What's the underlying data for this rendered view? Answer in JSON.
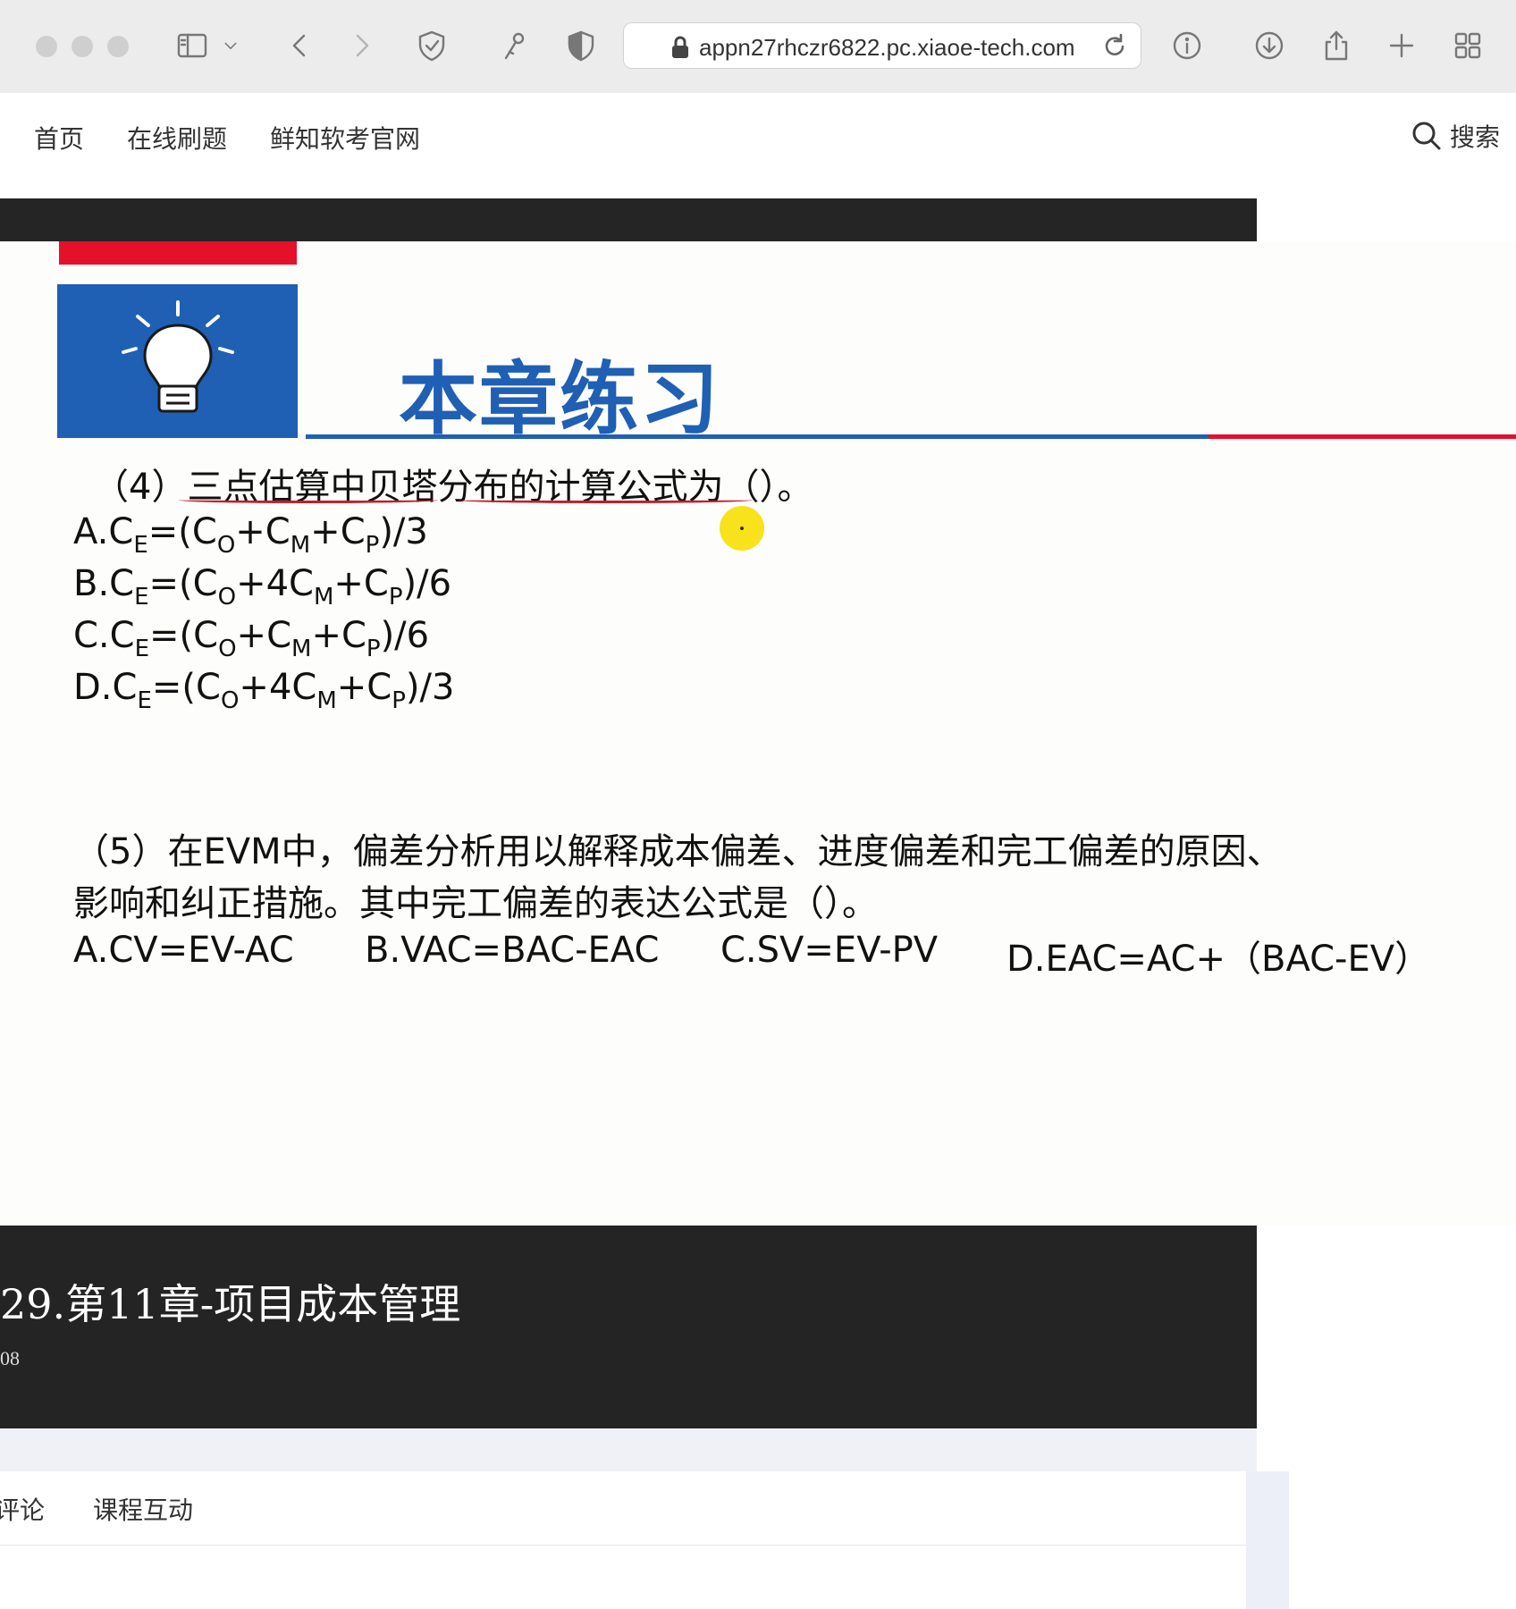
{
  "browser": {
    "url": "appn27rhczr6822.pc.xiaoe-tech.com",
    "icons": [
      "sidebar-icon",
      "chevron-down-icon",
      "back-icon",
      "forward-icon",
      "shield-icon",
      "key-icon",
      "privacy-icon",
      "lock-icon",
      "reload-icon",
      "info-icon",
      "download-icon",
      "share-icon",
      "new-tab-icon",
      "tab-overview-icon"
    ]
  },
  "nav": {
    "items": [
      "首页",
      "在线刷题",
      "鲜知软考官网"
    ],
    "search_label": "搜索"
  },
  "slide": {
    "title": "本章练习",
    "q4": {
      "prompt": "（4）三点估算中贝塔分布的计算公式为（）。",
      "options": [
        {
          "prefix": "A.C",
          "e": "E",
          "mid1": "=(C",
          "o": "O",
          "mid2": "+C",
          "m": "M",
          "mid3": "+C",
          "p": "P",
          "tail": ")/3"
        },
        {
          "prefix": "B.C",
          "e": "E",
          "mid1": "=(C",
          "o": "O",
          "mid2": "+4C",
          "m": "M",
          "mid3": "+C",
          "p": "P",
          "tail": ")/6"
        },
        {
          "prefix": "C.C",
          "e": "E",
          "mid1": "=(C",
          "o": "O",
          "mid2": "+C",
          "m": "M",
          "mid3": "+C",
          "p": "P",
          "tail": ")/6"
        },
        {
          "prefix": "D.C",
          "e": "E",
          "mid1": "=(C",
          "o": "O",
          "mid2": "+4C",
          "m": "M",
          "mid3": "+C",
          "p": "P",
          "tail": ")/3"
        }
      ]
    },
    "q5": {
      "line1": "（5）在EVM中，偏差分析用以解释成本偏差、进度偏差和完工偏差的原因、",
      "line2": "影响和纠正措施。其中完工偏差的表达公式是（）。",
      "options": [
        "A.CV=EV-AC",
        "B.VAC=BAC-EAC",
        "C.SV=EV-PV",
        "D.EAC=AC+（BAC-EV）"
      ]
    }
  },
  "video_info": {
    "title": "29.第11章-项目成本管理",
    "subtitle": "08"
  },
  "tabs": [
    "评论",
    "课程互动"
  ],
  "colors": {
    "accent_blue": "#1f5fb4",
    "accent_red": "#e5102a",
    "pointer_yellow": "#f7e21c",
    "dark_bar": "#242424"
  }
}
